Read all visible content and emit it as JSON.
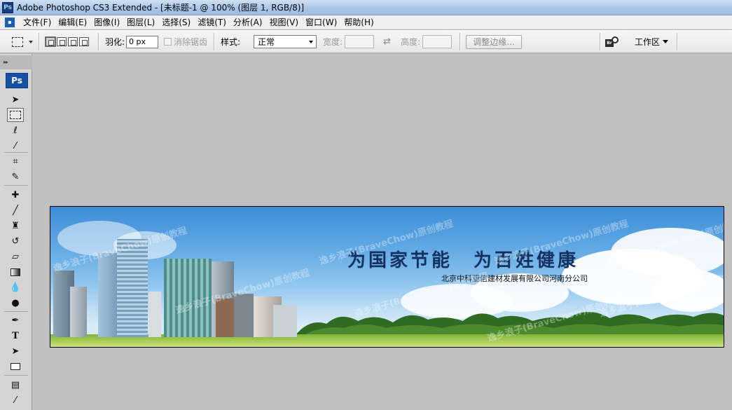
{
  "window": {
    "title": "Adobe Photoshop CS3 Extended - [未标题-1 @ 100% (图层 1, RGB/8)]",
    "app_badge": "Ps"
  },
  "menu": {
    "items": [
      "文件(F)",
      "编辑(E)",
      "图像(I)",
      "图层(L)",
      "选择(S)",
      "滤镜(T)",
      "分析(A)",
      "视图(V)",
      "窗口(W)",
      "帮助(H)"
    ]
  },
  "options": {
    "feather_label": "羽化:",
    "feather_value": "0 px",
    "antialias_label": "消除锯齿",
    "style_label": "样式:",
    "style_value": "正常",
    "width_label": "宽度:",
    "height_label": "高度:",
    "refine_edge_label": "调整边缘...",
    "bridge_label": "Br",
    "workspace_label": "工作区"
  },
  "toolbox": {
    "logo": "Ps",
    "tools": [
      "move",
      "rectangular-marquee",
      "lasso",
      "magic-wand",
      "crop",
      "slice",
      "healing-brush",
      "brush",
      "clone-stamp",
      "history-brush",
      "eraser",
      "gradient",
      "blur",
      "dodge",
      "pen",
      "type",
      "path-selection",
      "rectangle",
      "notes",
      "eyedropper"
    ]
  },
  "canvas": {
    "headline": "为国家节能　为百姓健康",
    "subline": "北京中科亚信建材发展有限公司河南分公司",
    "watermark": "逸乡浪子(BraveChow)原创教程"
  }
}
